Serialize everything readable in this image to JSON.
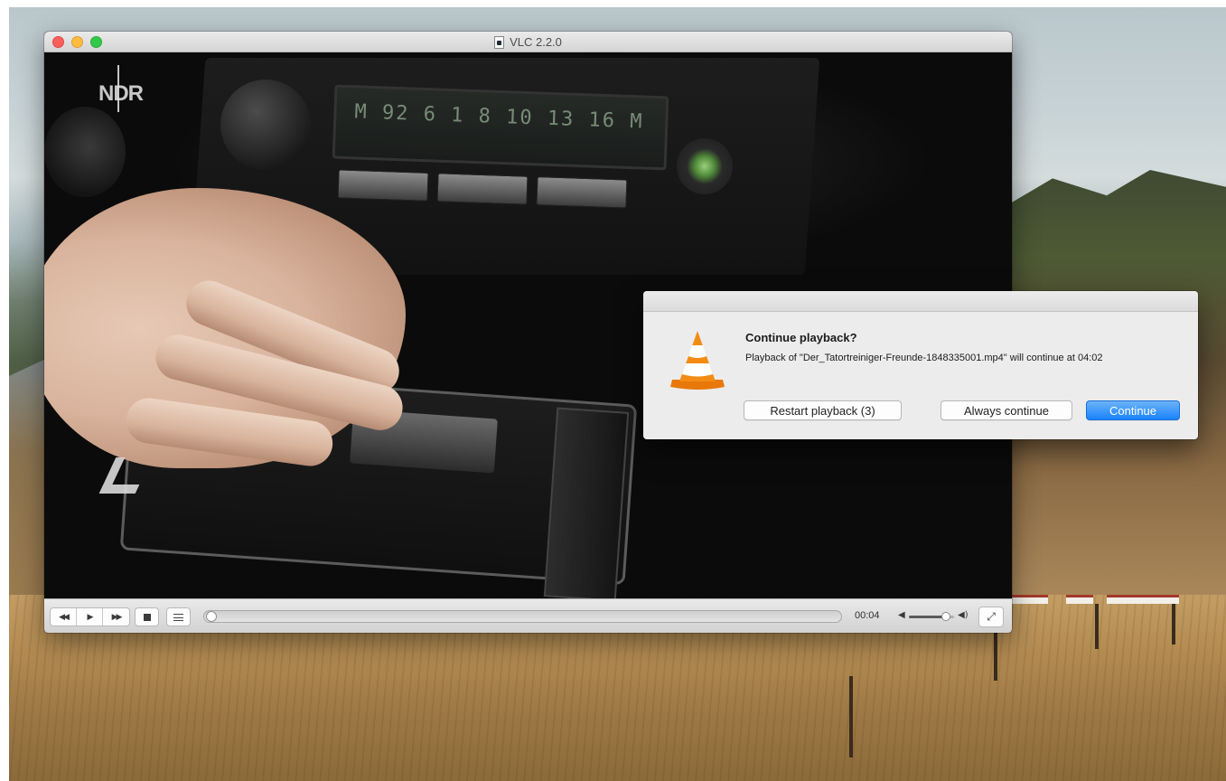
{
  "window": {
    "title": "VLC 2.2.0"
  },
  "video": {
    "channel_logo": "NDR",
    "radio_text": "M 92 6 1 8 10 13 16 M"
  },
  "controller": {
    "time": "00:04",
    "buttons": [
      "rewind-icon",
      "play-icon",
      "fast-forward-icon",
      "stop-icon",
      "playlist-icon",
      "fullscreen-icon"
    ]
  },
  "dialog": {
    "title": "Continue playback?",
    "message": "Playback of \"Der_Tatortreiniger-Freunde-1848335001.mp4\" will continue at 04:02",
    "restart_label": "Restart playback (3)",
    "always_label": "Always continue",
    "continue_label": "Continue",
    "accent_color": "#1a82fb"
  }
}
